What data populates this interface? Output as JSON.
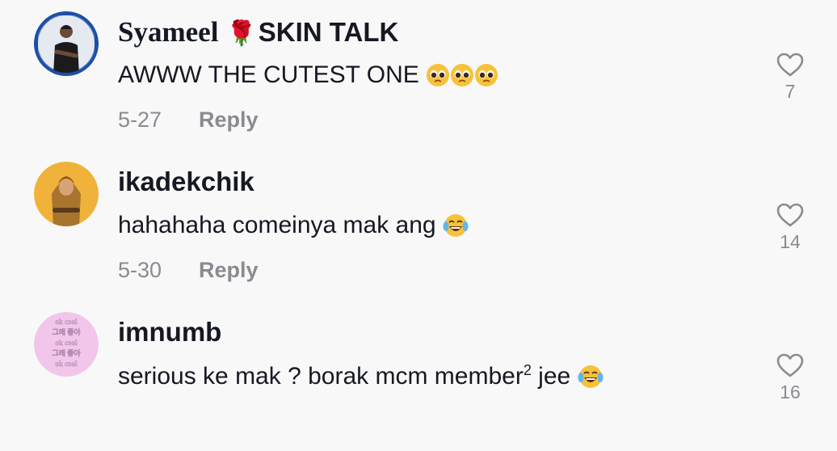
{
  "comments": [
    {
      "username_prefix": "Syameel",
      "rose_emoji": "🌹",
      "username_suffix": "SKIN TALK",
      "text": "AWWW THE CUTEST ONE",
      "emoji_icons": [
        "pleading-face-icon",
        "pleading-face-icon",
        "pleading-face-icon"
      ],
      "date": "5-27",
      "reply_label": "Reply",
      "likes": "7"
    },
    {
      "username": "ikadekchik",
      "text": "hahahaha comeinya mak ang",
      "emoji_icons": [
        "laughing-tears-icon"
      ],
      "date": "5-30",
      "reply_label": "Reply",
      "likes": "14"
    },
    {
      "username": "imnumb",
      "text_before": "serious ke mak ? borak mcm member",
      "superscript": "2",
      "text_after": " jee",
      "emoji_icons": [
        "laughing-tears-icon"
      ],
      "likes": "16"
    }
  ],
  "avatar_3_text": [
    "ok cool",
    "그래 좋아",
    "ok cool",
    "그래 좋아",
    "ok cool"
  ],
  "colors": {
    "background": "#f8f8f8",
    "primary_text": "#161823",
    "secondary_text": "#8a8b91",
    "avatar_1_bg": "#2f5fb3",
    "avatar_2_bg": "#f0b23a",
    "avatar_3_bg": "#f2c6ea"
  }
}
